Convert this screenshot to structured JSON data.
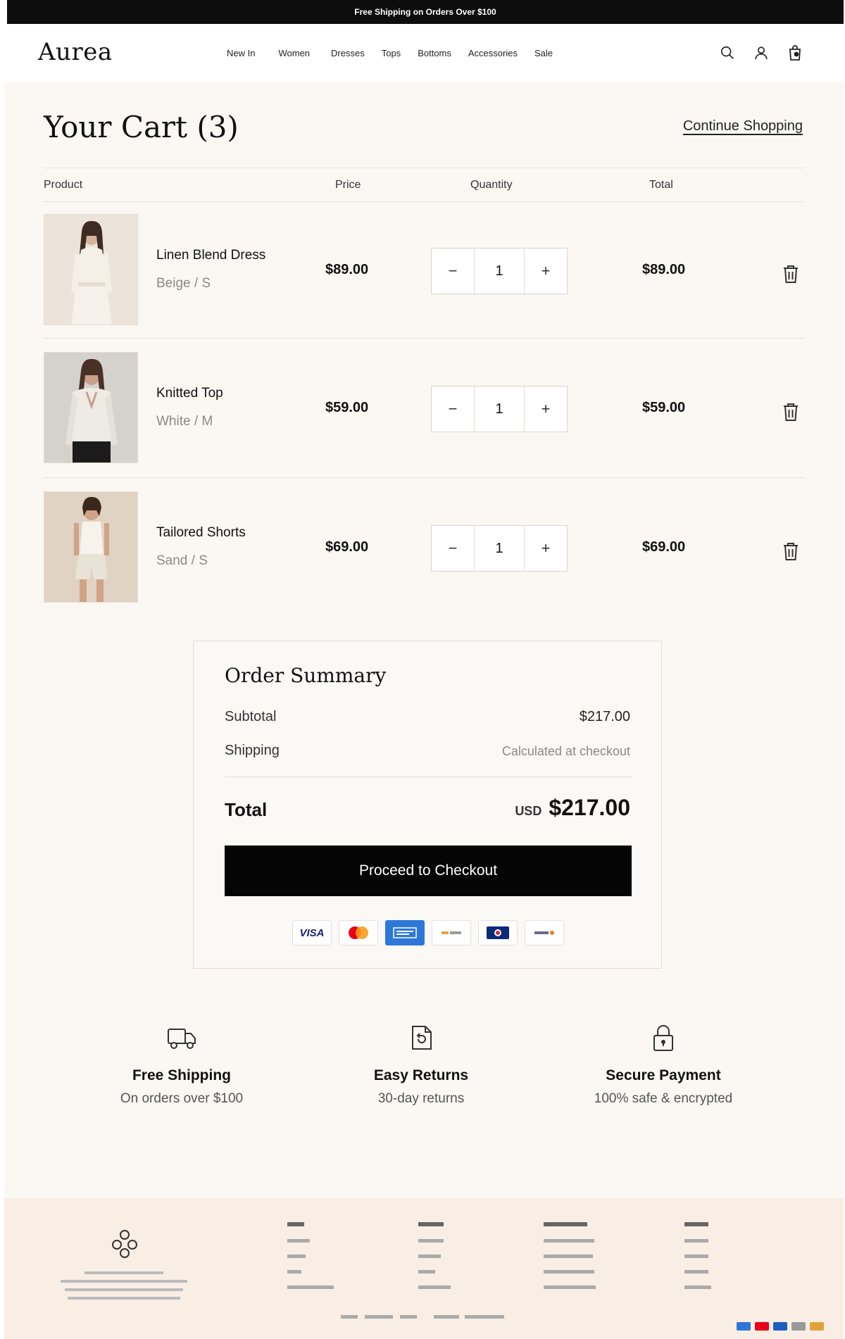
{
  "announcement": "Free Shipping on Orders Over $100",
  "header": {
    "logo": "Aurea",
    "nav": [
      "New In",
      "Women",
      "Dresses",
      "Tops",
      "Bottoms",
      "Accessories",
      "Sale"
    ],
    "icons": [
      "search-icon",
      "account-icon",
      "cart-icon"
    ]
  },
  "cart": {
    "title": "Your Cart (3)",
    "continue_label": "Continue Shopping",
    "columns": {
      "product": "Product",
      "price": "Price",
      "quantity": "Quantity",
      "total": "Total"
    },
    "items": [
      {
        "name": "Linen Blend Dress",
        "variant": "Beige / S",
        "price": "$89.00",
        "qty": "1",
        "total": "$89.00",
        "minus": "−",
        "plus": "+"
      },
      {
        "name": "Knitted Top",
        "variant": "White / M",
        "price": "$59.00",
        "qty": "1",
        "total": "$59.00",
        "minus": "−",
        "plus": "+"
      },
      {
        "name": "Tailored Shorts",
        "variant": "Sand / S",
        "price": "$69.00",
        "qty": "1",
        "total": "$69.00",
        "minus": "−",
        "plus": "+"
      }
    ]
  },
  "summary": {
    "title": "Order Summary",
    "subtotal_label": "Subtotal",
    "subtotal_value": "$217.00",
    "shipping_label": "Shipping",
    "shipping_value": "Calculated at checkout",
    "total_label": "Total",
    "currency": "USD",
    "total_value": "$217.00",
    "checkout_label": "Proceed to Checkout",
    "payment_methods": [
      "VISA",
      "mastercard-icon",
      "amex-icon",
      "apple-pay-icon",
      "diners-icon",
      "discover-icon"
    ]
  },
  "features": [
    {
      "icon": "truck-icon",
      "title": "Free Shipping",
      "subtitle": "On orders over $100"
    },
    {
      "icon": "returns-icon",
      "title": "Easy Returns",
      "subtitle": "30-day returns"
    },
    {
      "icon": "lock-icon",
      "title": "Secure Payment",
      "subtitle": "100% safe & encrypted"
    }
  ],
  "colors": {
    "accent": "#050505",
    "background": "#fbf8f4",
    "footer": "#f8eee4",
    "muted_text": "#8d8882"
  }
}
